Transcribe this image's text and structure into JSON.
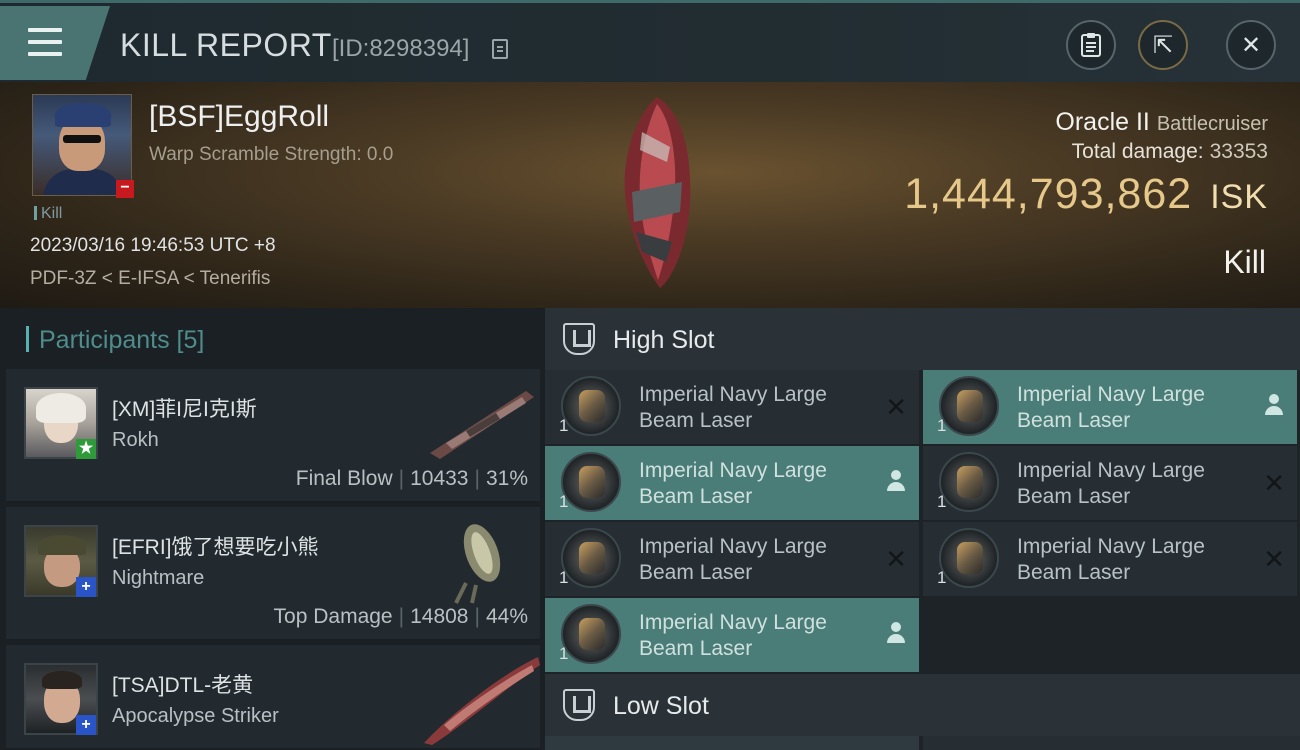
{
  "header": {
    "title": "KILL REPORT",
    "report_id": "[ID:8298394]",
    "close_glyph": "✕",
    "export_glyph": "⇱"
  },
  "victim": {
    "name": "[BSF]EggRoll",
    "warp_scramble": "Warp Scramble Strength: 0.0",
    "kill_tag": "Kill",
    "timestamp": "2023/03/16 19:46:53 UTC +8",
    "location": "PDF-3Z < E-IFSA < Tenerifis",
    "ship_name": "Oracle II",
    "ship_class": "Battlecruiser",
    "total_damage_label": "Total damage:",
    "total_damage_value": "33353",
    "isk_value": "1,444,793,862",
    "isk_unit": "ISK",
    "result": "Kill",
    "badge": "−"
  },
  "participants": {
    "header": "Participants [5]",
    "items": [
      {
        "name": "[XM]菲I尼I克I斯",
        "ship": "Rokh",
        "role": "Final Blow",
        "damage": "10433",
        "percent": "31%",
        "badge": "★",
        "badge_color": "#2f9a3a"
      },
      {
        "name": "[EFRI]饿了想要吃小熊",
        "ship": "Nightmare",
        "role": "Top Damage",
        "damage": "14808",
        "percent": "44%",
        "badge": "+",
        "badge_color": "#2a55c8"
      },
      {
        "name": "[TSA]DTL-老黄",
        "ship": "Apocalypse Striker",
        "role": "",
        "damage": "",
        "percent": "",
        "badge": "+",
        "badge_color": "#2a55c8"
      }
    ]
  },
  "slots": {
    "high_title": "High Slot",
    "low_title": "Low Slot",
    "high_modules": [
      {
        "line1": "Imperial Navy Large",
        "line2": "Beam Laser",
        "qty": "1",
        "status": "destroyed",
        "status_glyph": "✕"
      },
      {
        "line1": "Imperial Navy Large",
        "line2": "Beam Laser",
        "qty": "1",
        "status": "dropped",
        "status_glyph": ""
      },
      {
        "line1": "Imperial Navy Large",
        "line2": "Beam Laser",
        "qty": "1",
        "status": "dropped",
        "status_glyph": ""
      },
      {
        "line1": "Imperial Navy Large",
        "line2": "Beam Laser",
        "qty": "1",
        "status": "destroyed",
        "status_glyph": "✕"
      },
      {
        "line1": "Imperial Navy Large",
        "line2": "Beam Laser",
        "qty": "1",
        "status": "destroyed",
        "status_glyph": "✕"
      },
      {
        "line1": "Imperial Navy Large",
        "line2": "Beam Laser",
        "qty": "1",
        "status": "destroyed",
        "status_glyph": "✕"
      },
      {
        "line1": "Imperial Navy Large",
        "line2": "Beam Laser",
        "qty": "1",
        "status": "dropped",
        "status_glyph": ""
      }
    ]
  }
}
